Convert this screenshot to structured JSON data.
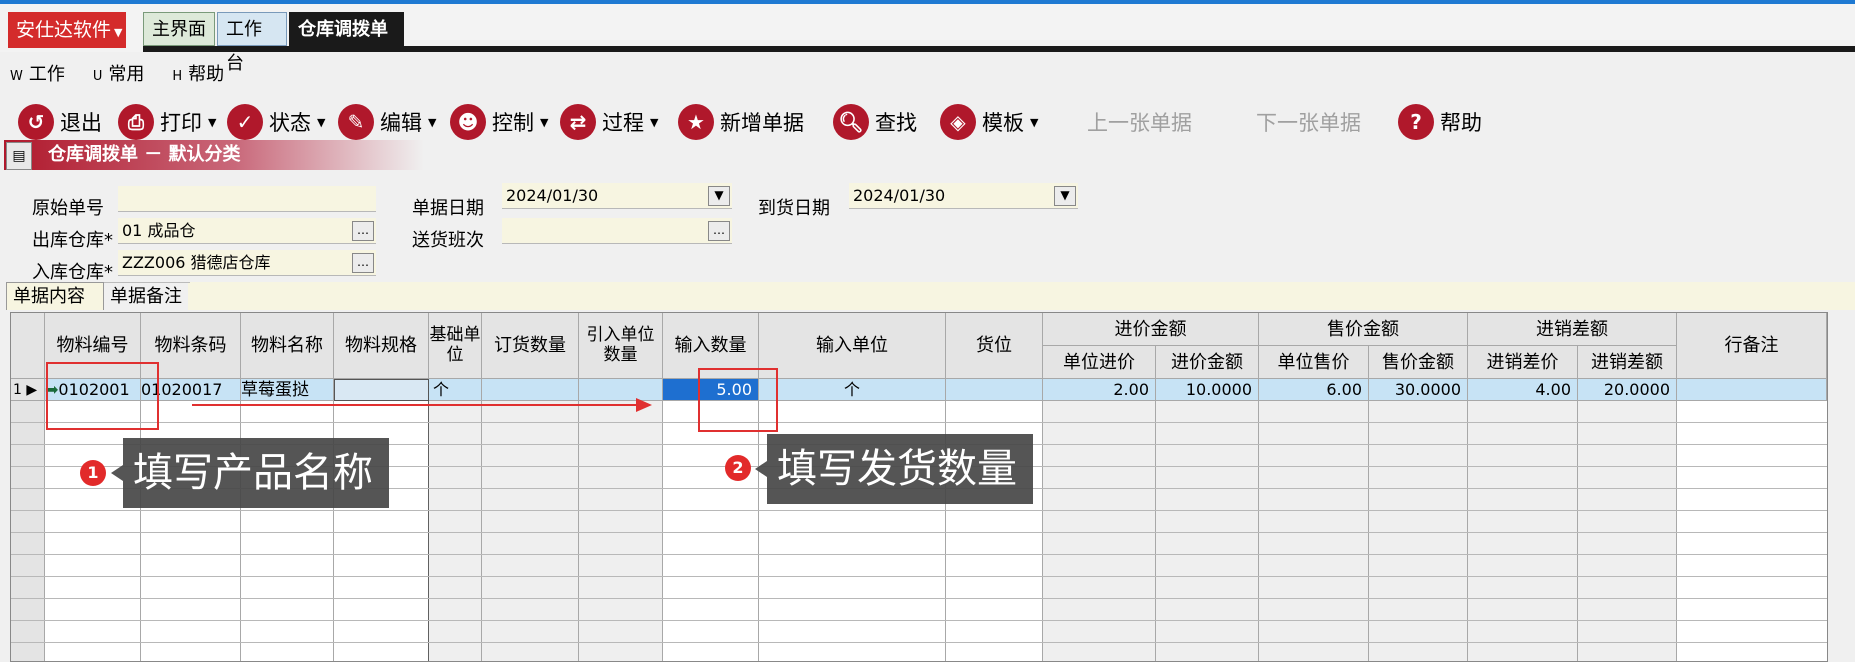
{
  "app": {
    "brand": "安仕达软件",
    "tabs": [
      "主界面",
      "工作台",
      "仓库调拨单"
    ]
  },
  "menu": [
    {
      "accel": "W",
      "label": "工作"
    },
    {
      "accel": "U",
      "label": "常用"
    },
    {
      "accel": "H",
      "label": "帮助"
    }
  ],
  "toolbar": {
    "exit": "退出",
    "print": "打印",
    "status": "状态",
    "edit": "编辑",
    "control": "控制",
    "process": "过程",
    "new_doc": "新增单据",
    "find": "查找",
    "template": "模板",
    "prev": "上一张单据",
    "next": "下一张单据",
    "help": "帮助"
  },
  "section": {
    "title": "仓库调拨单 － 默认分类"
  },
  "form": {
    "orig_no_label": "原始单号",
    "orig_no_value": "",
    "doc_date_label": "单据日期",
    "doc_date_value": "2024/01/30",
    "arrive_date_label": "到货日期",
    "arrive_date_value": "2024/01/30",
    "out_wh_label": "出库仓库*",
    "out_wh_value": "01  成品仓",
    "delivery_label": "送货班次",
    "delivery_value": "",
    "in_wh_label": "入库仓库*",
    "in_wh_value": "ZZZ006  猎德店仓库"
  },
  "subtabs": [
    "单据内容",
    "单据备注"
  ],
  "grid": {
    "headers": {
      "code": "物料编号",
      "barcode": "物料条码",
      "name": "物料名称",
      "spec": "物料规格",
      "base_unit": "基础单位",
      "order_qty": "订货数量",
      "import_qty": "引入单位数量",
      "input_qty": "输入数量",
      "input_unit": "输入单位",
      "location": "货位",
      "buy_group": "进价金额",
      "buy_unit": "单位进价",
      "buy_amount": "进价金额",
      "sell_group": "售价金额",
      "sell_unit": "单位售价",
      "sell_amount": "售价金额",
      "diff_group": "进销差额",
      "diff_unit": "进销差价",
      "diff_amount": "进销差额",
      "remark": "行备注"
    },
    "row1": {
      "index": "1",
      "code": "0102001",
      "barcode": "01020017",
      "name": "草莓蛋挞",
      "spec": "",
      "base_unit": "个",
      "input_qty": "5.00",
      "input_unit": "个",
      "buy_unit": "2.00",
      "buy_amount": "10.0000",
      "sell_unit": "6.00",
      "sell_amount": "30.0000",
      "diff_unit": "4.00",
      "diff_amount": "20.0000"
    }
  },
  "annotations": {
    "step1_num": "1",
    "step1_text": "填写产品名称",
    "step2_num": "2",
    "step2_text": "填写发货数量"
  }
}
